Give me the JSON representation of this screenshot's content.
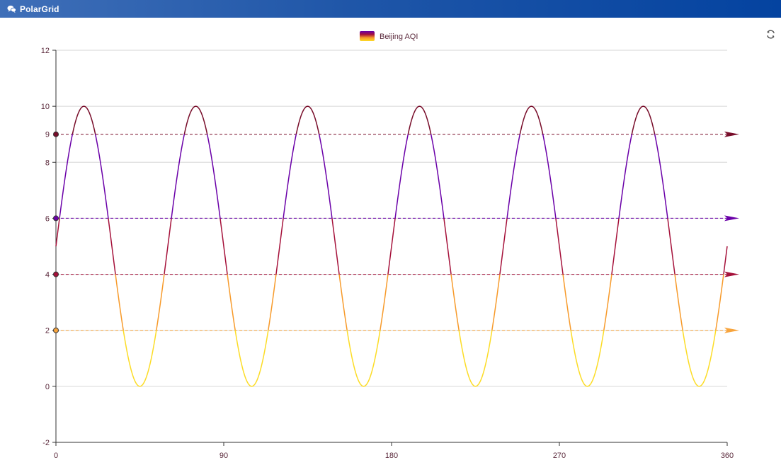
{
  "window": {
    "title": "PolarGrid",
    "icon": "chat-bubbles-icon",
    "refresh_icon": "refresh-icon"
  },
  "chart_data": {
    "type": "line",
    "series": [
      {
        "name": "Beijing AQI",
        "function": "5*sin(x*pi/30)+5",
        "x_step": 1,
        "x_range": [
          0,
          360
        ]
      }
    ],
    "xlim": [
      0,
      360
    ],
    "ylim": [
      -2,
      12
    ],
    "x_ticks": [
      0,
      90,
      180,
      270,
      360
    ],
    "y_ticks": [
      -2,
      0,
      2,
      4,
      6,
      8,
      10,
      12
    ],
    "y_grid": [
      0,
      2,
      4,
      6,
      8,
      10,
      12
    ],
    "legend_placement": "top-center",
    "visual_map": {
      "pieces": [
        {
          "from": 0,
          "to": 2,
          "color": "#fcdc26"
        },
        {
          "from": 2,
          "to": 4,
          "color": "#f79a2a"
        },
        {
          "from": 4,
          "to": 6,
          "color": "#a5113a"
        },
        {
          "from": 6,
          "to": 9,
          "color": "#6a00a8"
        },
        {
          "from": 9,
          "to": 10,
          "color": "#780d2a"
        }
      ]
    },
    "mark_lines": [
      {
        "y": 2,
        "color": "#f7a43d"
      },
      {
        "y": 4,
        "color": "#a5113a"
      },
      {
        "y": 6,
        "color": "#6a00a8"
      },
      {
        "y": 9,
        "color": "#780d2a"
      }
    ]
  }
}
